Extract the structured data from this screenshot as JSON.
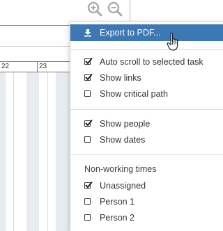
{
  "toolbar": {
    "zoom_in_icon": "zoom-in-icon",
    "zoom_out_icon": "zoom-out-icon"
  },
  "timeline": {
    "days": [
      "22",
      "23"
    ]
  },
  "menu": {
    "export_label": "Export to PDF...",
    "options": [
      {
        "label": "Auto scroll to selected task",
        "checked": true
      },
      {
        "label": "Show links",
        "checked": true
      },
      {
        "label": "Show critical path",
        "checked": false
      }
    ],
    "display": [
      {
        "label": "Show people",
        "checked": true
      },
      {
        "label": "Show dates",
        "checked": false
      }
    ],
    "nonworking_title": "Non-working times",
    "nonworking": [
      {
        "label": "Unassigned",
        "checked": true
      },
      {
        "label": "Person 1",
        "checked": false
      },
      {
        "label": "Person 2",
        "checked": false
      }
    ]
  },
  "colors": {
    "highlight": "#3c78b4",
    "stripe": "#e9ebf3"
  }
}
